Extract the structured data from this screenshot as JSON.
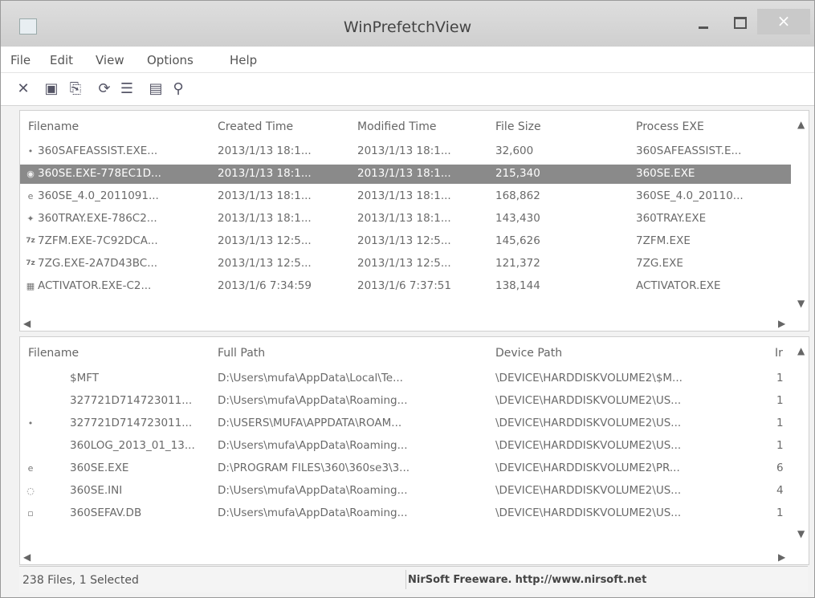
{
  "window": {
    "title": "WinPrefetchView",
    "close_label": "×"
  },
  "menu": [
    "File",
    "Edit",
    "View",
    "Options",
    "Help"
  ],
  "toolbar": [
    {
      "icon": "delete-icon",
      "glyph": "✕"
    },
    {
      "icon": "save-icon",
      "glyph": "▣"
    },
    {
      "icon": "copy-icon",
      "glyph": "⎘"
    },
    {
      "icon": "refresh-icon",
      "glyph": "⟳"
    },
    {
      "icon": "properties-icon",
      "glyph": "☰"
    },
    {
      "icon": "html-report-icon",
      "glyph": "▤"
    },
    {
      "icon": "find-icon",
      "glyph": "⚲"
    }
  ],
  "top_table": {
    "columns": [
      "Filename",
      "Created Time",
      "Modified Time",
      "File Size",
      "Process EXE"
    ],
    "rows": [
      {
        "icon": "•",
        "filename": "360SAFEASSIST.EXE...",
        "created": "2013/1/13 18:1...",
        "modified": "2013/1/13 18:1...",
        "size": "32,600",
        "process": "360SAFEASSIST.E..."
      },
      {
        "icon": "◉",
        "filename": "360SE.EXE-778EC1D...",
        "created": "2013/1/13 18:1...",
        "modified": "2013/1/13 18:1...",
        "size": "215,340",
        "process": "360SE.EXE",
        "selected": true
      },
      {
        "icon": "e",
        "filename": "360SE_4.0_2011091...",
        "created": "2013/1/13 18:1...",
        "modified": "2013/1/13 18:1...",
        "size": "168,862",
        "process": "360SE_4.0_20110..."
      },
      {
        "icon": "✦",
        "filename": "360TRAY.EXE-786C2...",
        "created": "2013/1/13 18:1...",
        "modified": "2013/1/13 18:1...",
        "size": "143,430",
        "process": "360TRAY.EXE"
      },
      {
        "icon": "7z",
        "filename": "7ZFM.EXE-7C92DCA...",
        "created": "2013/1/13 12:5...",
        "modified": "2013/1/13 12:5...",
        "size": "145,626",
        "process": "7ZFM.EXE"
      },
      {
        "icon": "7z",
        "filename": "7ZG.EXE-2A7D43BC...",
        "created": "2013/1/13 12:5...",
        "modified": "2013/1/13 12:5...",
        "size": "121,372",
        "process": "7ZG.EXE"
      },
      {
        "icon": "▦",
        "filename": "ACTIVATOR.EXE-C2...",
        "created": "2013/1/6 7:34:59",
        "modified": "2013/1/6 7:37:51",
        "size": "138,144",
        "process": "ACTIVATOR.EXE"
      }
    ]
  },
  "bottom_table": {
    "columns": [
      "Filename",
      "Full Path",
      "Device Path",
      "Ir"
    ],
    "rows": [
      {
        "icon": "",
        "filename": "$MFT",
        "full_path": "D:\\Users\\mufa\\AppData\\Local\\Te...",
        "device_path": "\\DEVICE\\HARDDISKVOLUME2\\$M...",
        "index": "1"
      },
      {
        "icon": "",
        "filename": "327721D714723011...",
        "full_path": "D:\\Users\\mufa\\AppData\\Roaming...",
        "device_path": "\\DEVICE\\HARDDISKVOLUME2\\US...",
        "index": "1"
      },
      {
        "icon": "•",
        "filename": "327721D714723011...",
        "full_path": "D:\\USERS\\MUFA\\APPDATA\\ROAM...",
        "device_path": "\\DEVICE\\HARDDISKVOLUME2\\US...",
        "index": "1"
      },
      {
        "icon": "",
        "filename": "360LOG_2013_01_13...",
        "full_path": "D:\\Users\\mufa\\AppData\\Roaming...",
        "device_path": "\\DEVICE\\HARDDISKVOLUME2\\US...",
        "index": "1"
      },
      {
        "icon": "e",
        "filename": "360SE.EXE",
        "full_path": "D:\\PROGRAM FILES\\360\\360se3\\3...",
        "device_path": "\\DEVICE\\HARDDISKVOLUME2\\PR...",
        "index": "6"
      },
      {
        "icon": "◌",
        "filename": "360SE.INI",
        "full_path": "D:\\Users\\mufa\\AppData\\Roaming...",
        "device_path": "\\DEVICE\\HARDDISKVOLUME2\\US...",
        "index": "4"
      },
      {
        "icon": "▫",
        "filename": "360SEFAV.DB",
        "full_path": "D:\\Users\\mufa\\AppData\\Roaming...",
        "device_path": "\\DEVICE\\HARDDISKVOLUME2\\US...",
        "index": "1"
      }
    ]
  },
  "status": {
    "files": "238 Files, 1 Selected",
    "brand": "NirSoft Freeware.",
    "url": "http://www.nirsoft.net"
  }
}
